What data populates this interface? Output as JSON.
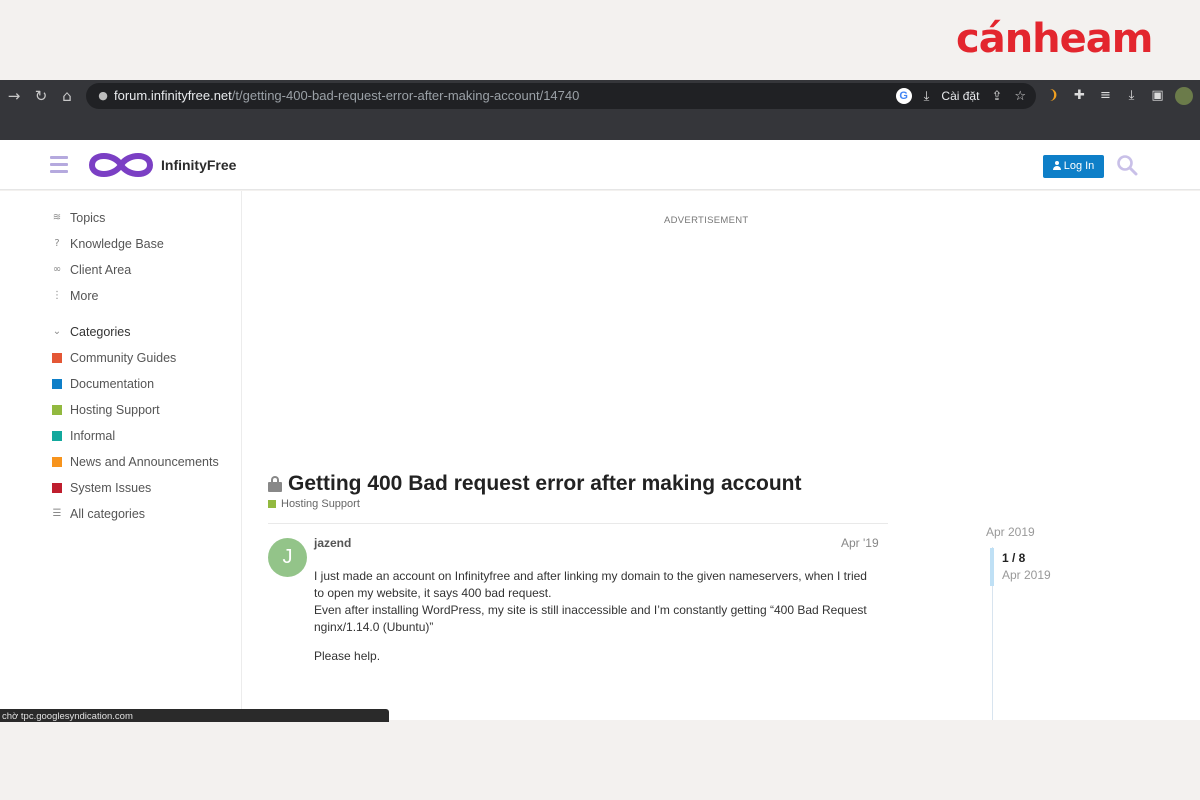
{
  "brand": {
    "name": "cánheam",
    "color": "#e3262e"
  },
  "browser": {
    "url_host": "forum.infinityfree.net",
    "url_path": "/t/getting-400-bad-request-error-after-making-account/14740",
    "install_label": "Cài đặt",
    "status_text": "chờ tpc.googlesyndication.com",
    "icons": [
      "forward-arrow-icon",
      "reload-icon",
      "home-icon",
      "lock-icon",
      "google-icon",
      "install-icon",
      "share-icon",
      "star-icon",
      "extensions-icon",
      "reading-list-icon",
      "download-icon",
      "sidebar-icon",
      "profile-icon"
    ]
  },
  "header": {
    "logo_text": "InfinityFree",
    "login_label": "Log In",
    "accent": "#0e7fc8"
  },
  "sidebar": {
    "links": [
      {
        "label": "Topics",
        "icon": "layers-icon"
      },
      {
        "label": "Knowledge Base",
        "icon": "question-icon"
      },
      {
        "label": "Client Area",
        "icon": "link-icon"
      },
      {
        "label": "More",
        "icon": "ellipsis-vertical-icon"
      }
    ],
    "categories_label": "Categories",
    "categories": [
      {
        "label": "Community Guides",
        "color": "#e45735"
      },
      {
        "label": "Documentation",
        "color": "#0e7fc8"
      },
      {
        "label": "Hosting Support",
        "color": "#92b93f"
      },
      {
        "label": "Informal",
        "color": "#12a89d"
      },
      {
        "label": "News and Announcements",
        "color": "#f7941d"
      },
      {
        "label": "System Issues",
        "color": "#bf1e2e"
      }
    ],
    "all_categories_label": "All categories"
  },
  "main": {
    "ad_label": "ADVERTISEMENT",
    "topic": {
      "title": "Getting 400 Bad request error after making account",
      "category": "Hosting Support",
      "category_color": "#92b93f"
    },
    "post": {
      "avatar_letter": "J",
      "author": "jazend",
      "date": "Apr '19",
      "paragraphs": [
        "I just made an account on Infinityfree and after linking my domain to the given nameservers, when I tried to open my website, it says 400 bad request.\nEven after installing WordPress, my site is still inaccessible and I’m constantly getting “400 Bad Request\nnginx/1.14.0 (Ubuntu)”",
        "Please help."
      ]
    },
    "timeline": {
      "top_date": "Apr 2019",
      "count": "1 / 8",
      "date": "Apr 2019"
    }
  }
}
